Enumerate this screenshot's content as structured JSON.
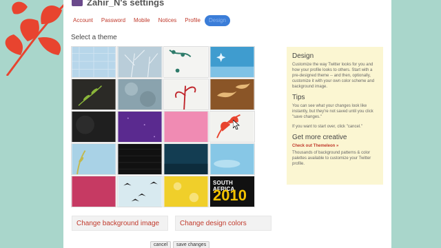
{
  "header": {
    "title": "Zahir_N's settings"
  },
  "tabs": [
    {
      "label": "Account",
      "active": false
    },
    {
      "label": "Password",
      "active": false
    },
    {
      "label": "Mobile",
      "active": false
    },
    {
      "label": "Notices",
      "active": false
    },
    {
      "label": "Profile",
      "active": false
    },
    {
      "label": "Design",
      "active": true
    }
  ],
  "themes_heading": "Select a theme",
  "theme_sa": {
    "top_text": "SOUTH AFRICA",
    "year": "2010"
  },
  "sidebar": {
    "design_heading": "Design",
    "design_text": "Customize the way Twitter looks for you and how your profile looks to others. Start with a pre-designed theme -- and then, optionally, customize it with your own color scheme and background image.",
    "tips_heading": "Tips",
    "tips_text": "You can see what your changes look like instantly, but they're not saved until you click \"save changes.\"",
    "tips_text2": "If you want to start over, click \"cancel.\"",
    "creative_heading": "Get more creative",
    "creative_link": "Check out Themeleon »",
    "creative_text": "Thousands of background patterns & color palettes available to customize your Twitter profile."
  },
  "buttons": {
    "change_background": "Change background image",
    "change_colors": "Change design colors",
    "cancel": "cancel",
    "save": "save changes"
  },
  "colors": {
    "page_background": "#a9d6cb",
    "link_red": "#c0392b",
    "active_tab": "#3b7dd8",
    "sidebar_bg": "#fbf6d2"
  }
}
